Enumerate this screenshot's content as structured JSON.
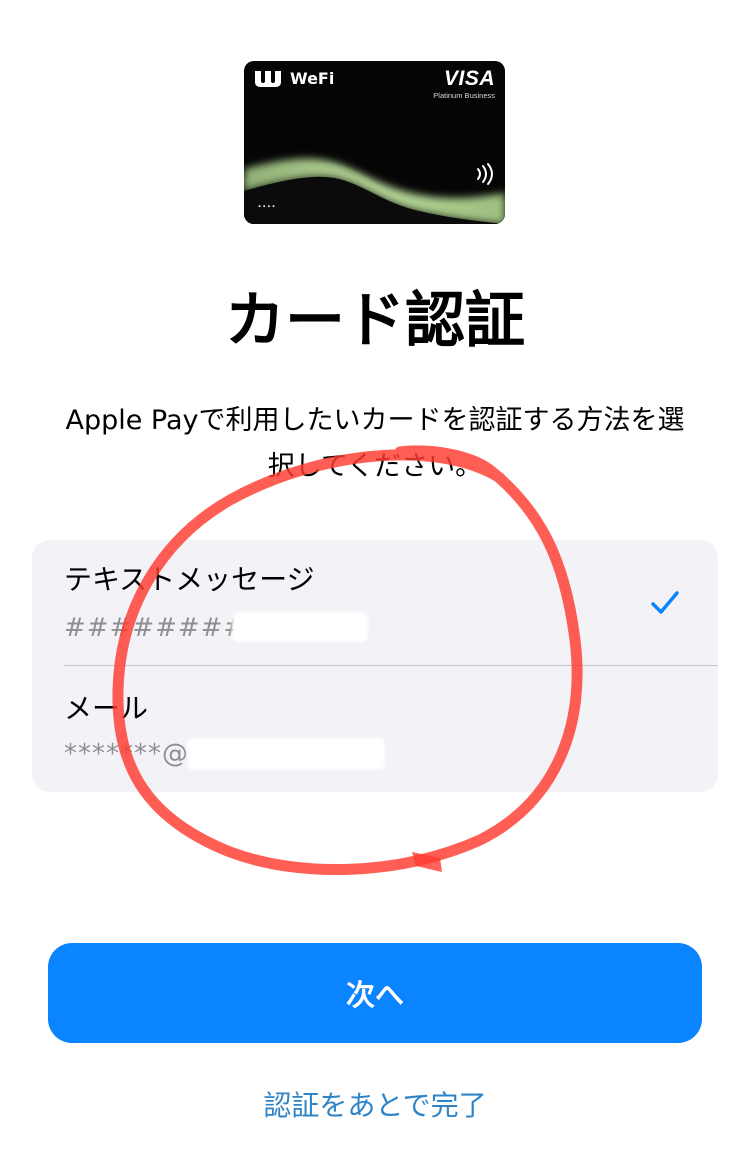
{
  "card": {
    "brand": "WeFi",
    "network": "VISA",
    "tier": "Platinum Business",
    "number_masked": "····",
    "colors": {
      "body": "#050505",
      "accent": "#a9c98a"
    }
  },
  "title": "カード認証",
  "description": "Apple Payで利用したいカードを認証する方法を選択してください。",
  "options": [
    {
      "label": "テキストメッセージ",
      "detail": "##########",
      "selected": true,
      "icon": "checkmark-icon"
    },
    {
      "label": "メール",
      "detail": "*******@",
      "selected": false
    }
  ],
  "primary_button": {
    "label": "次へ"
  },
  "secondary_link": {
    "label": "認証をあとで完了"
  },
  "colors": {
    "accent": "#0a84ff",
    "link": "#2f84c7",
    "list_background": "#f2f2f7",
    "annotation": "#ff3b30"
  }
}
